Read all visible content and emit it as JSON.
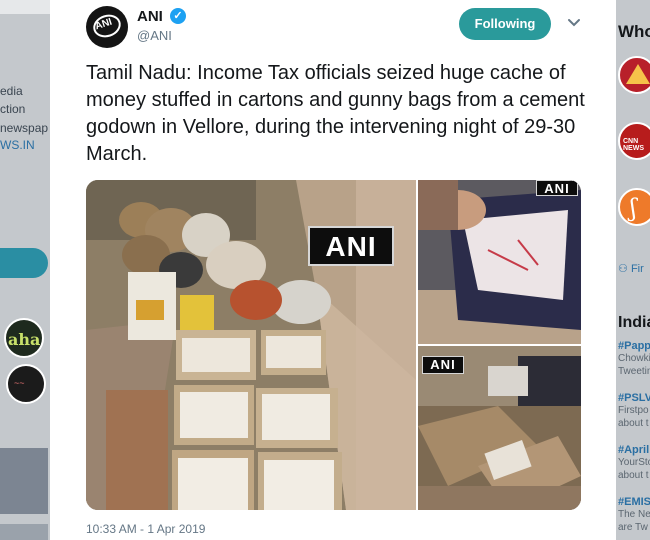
{
  "left_sidebar": {
    "lines": [
      "edia",
      "ction",
      "newspap",
      "WS.IN"
    ]
  },
  "tweet": {
    "author_name": "ANI",
    "author_handle": "@ANI",
    "avatar_text": "ANI",
    "verified_mark": "✓",
    "follow_button": "Following",
    "text": "Tamil Nadu: Income Tax officials seized huge cache of money stuffed in cartons and gunny bags from a cement godown in Vellore, during the intervening night of 29-30 March.",
    "media_watermark": "ANI",
    "timestamp": "10:33 AM - 1 Apr 2019"
  },
  "right_sidebar": {
    "who_to_follow_title": "Who",
    "find_link": "Fir",
    "trends_title": "India",
    "trends": [
      {
        "tag": "#Papp",
        "lines": [
          "Chowki",
          "Tweetin"
        ]
      },
      {
        "tag": "#PSLV",
        "lines": [
          "Firstpo",
          "about t"
        ]
      },
      {
        "tag": "#April",
        "lines": [
          "YourSto",
          "about t"
        ]
      },
      {
        "tag": "#EMIS",
        "lines": [
          "The Ne",
          "are Tw"
        ]
      }
    ]
  },
  "colors": {
    "accent": "#2a9a9b",
    "verified": "#1da1f2",
    "link": "#2a6fa3"
  }
}
